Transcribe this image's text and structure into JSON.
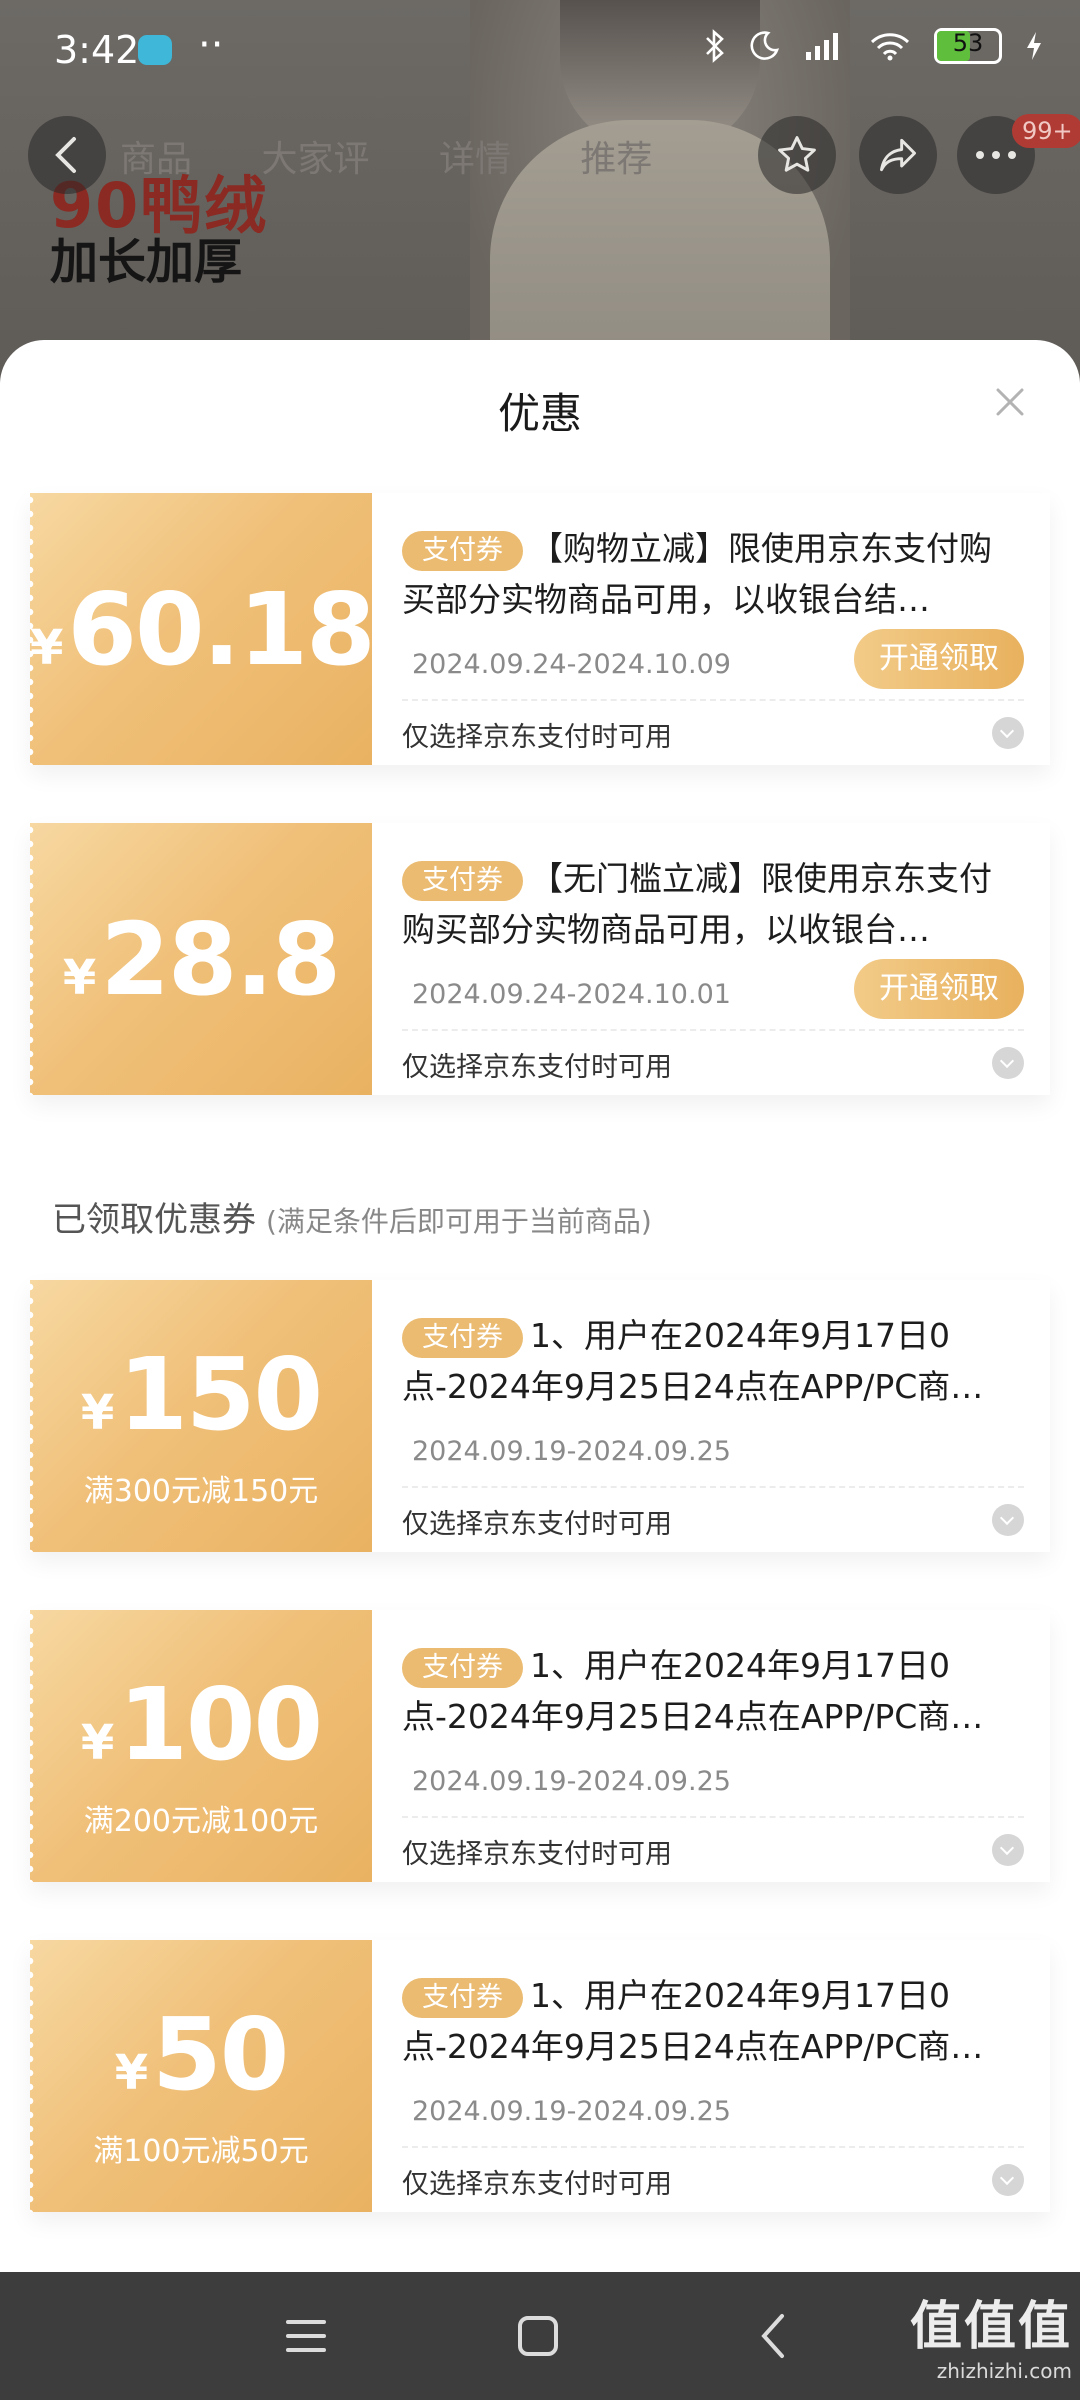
{
  "status_bar": {
    "time": "3:42",
    "dots": "··",
    "battery": "53",
    "battery_level": 0.53,
    "icons": [
      "bluetooth-icon",
      "moon-icon",
      "signal-icon",
      "wifi-icon",
      "battery-icon",
      "charging-icon"
    ]
  },
  "background": {
    "promo_line1": "90鸭绒",
    "promo_line2": "加长加厚",
    "tabs": [
      "商品",
      "大家评",
      "详情",
      "推荐"
    ],
    "cart_badge": "99+"
  },
  "sheet": {
    "title": "优惠"
  },
  "coupons": [
    {
      "currency": "¥",
      "amount": "60.18",
      "tag": "支付券",
      "description": "【购物立减】限使用京东支付购买部分实物商品可用，以收银台结…",
      "date_range": "2024.09.24-2024.10.09",
      "button": "开通领取",
      "note": "仅选择京东支付时可用"
    },
    {
      "currency": "¥",
      "amount": "28.8",
      "tag": "支付券",
      "description": "【无门槛立减】限使用京东支付购买部分实物商品可用，以收银台…",
      "date_range": "2024.09.24-2024.10.01",
      "button": "开通领取",
      "note": "仅选择京东支付时可用"
    }
  ],
  "claimed_section": {
    "title": "已领取优惠券",
    "subtitle": "(满足条件后即可用于当前商品)"
  },
  "claimed_coupons": [
    {
      "currency": "¥",
      "amount": "150",
      "condition": "满300元减150元",
      "tag": "支付券",
      "description": "1、用户在2024年9月17日0点-2024年9月25日24点在APP/PC商…",
      "date_range": "2024.09.19-2024.09.25",
      "note": "仅选择京东支付时可用"
    },
    {
      "currency": "¥",
      "amount": "100",
      "condition": "满200元减100元",
      "tag": "支付券",
      "description": "1、用户在2024年9月17日0点-2024年9月25日24点在APP/PC商…",
      "date_range": "2024.09.19-2024.09.25",
      "note": "仅选择京东支付时可用"
    },
    {
      "currency": "¥",
      "amount": "50",
      "condition": "满100元减50元",
      "tag": "支付券",
      "description": "1、用户在2024年9月17日0点-2024年9月25日24点在APP/PC商…",
      "date_range": "2024.09.19-2024.09.25",
      "note": "仅选择京东支付时可用"
    }
  ],
  "watermark": {
    "big": "值值值",
    "small": "zhizhizhi.com"
  },
  "colors": {
    "coupon_gold": "#eabb70",
    "overlay": "#5e5a56",
    "navbar": "#3d3d3d"
  }
}
